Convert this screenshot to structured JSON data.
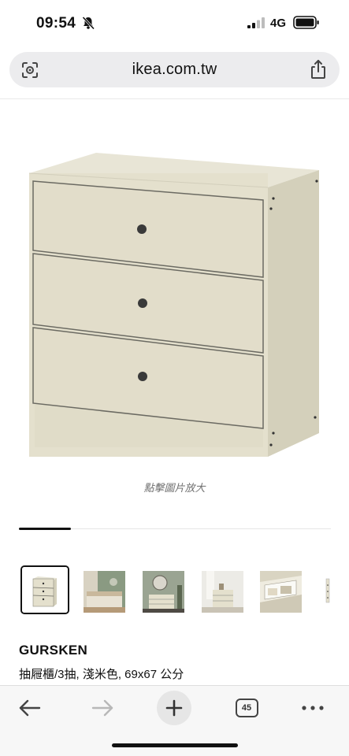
{
  "status_bar": {
    "time": "09:54",
    "network": "4G"
  },
  "browser": {
    "url": "ikea.com.tw",
    "tab_count": "45"
  },
  "product": {
    "caption": "點擊圖片放大",
    "name": "GURSKEN",
    "description": "抽屜櫃/3抽, 淺米色, 69x67 公分"
  },
  "gallery": {
    "selected_index": 0,
    "thumbnails": [
      {
        "subject": "dresser-front"
      },
      {
        "subject": "bedroom-scene"
      },
      {
        "subject": "mirror-room-scene"
      },
      {
        "subject": "dresser-room-scene"
      },
      {
        "subject": "open-drawer-detail"
      },
      {
        "subject": "partial-thumbnail"
      }
    ]
  },
  "colors": {
    "dresser": "#e4e0ce",
    "knob": "#3a3a3a",
    "url_bar": "#ececee"
  }
}
